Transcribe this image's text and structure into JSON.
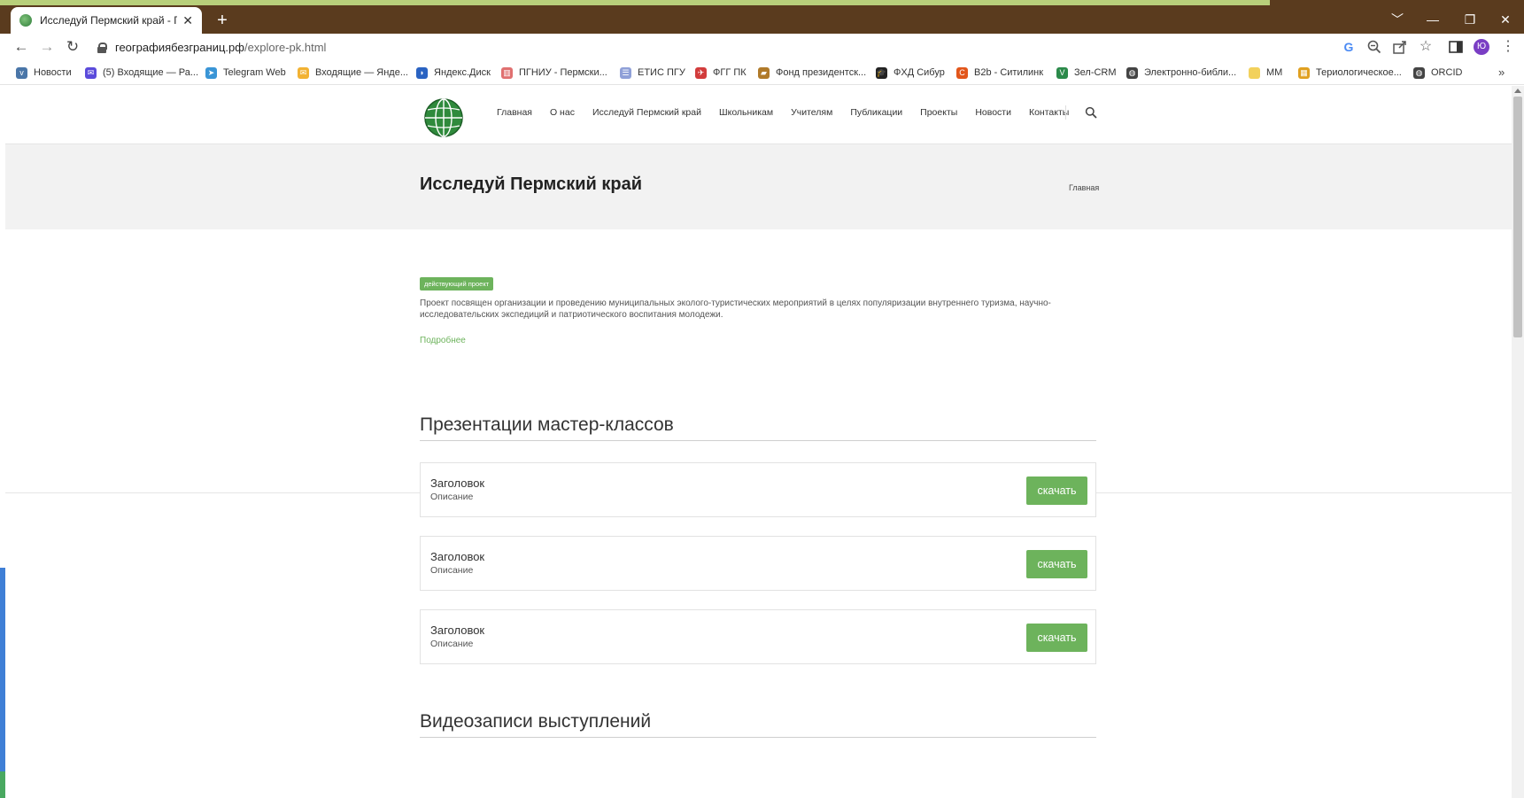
{
  "browser": {
    "tab_title": "Исследуй Пермский край - Геог",
    "tab_close": "✕",
    "new_tab": "+",
    "window_controls": [
      "﹀",
      "—",
      "❐",
      "✕"
    ],
    "url_host": "географиябезграниц.рф",
    "url_path": "/explore-pk.html",
    "profile_initial": "Ю",
    "bookmarks": [
      {
        "label": "Новости",
        "icon": "vk-icon",
        "color": "#4a76a8",
        "glyph": "v"
      },
      {
        "label": "(5) Входящие — Ра...",
        "icon": "mail-icon",
        "color": "#5b4bdb",
        "glyph": "✉"
      },
      {
        "label": "Telegram Web",
        "icon": "telegram-icon",
        "color": "#3a95d6",
        "glyph": "➤"
      },
      {
        "label": "Входящие — Янде...",
        "icon": "yandex-mail-icon",
        "color": "#f2b233",
        "glyph": "✉"
      },
      {
        "label": "Яндекс.Диск",
        "icon": "yandex-disk-icon",
        "color": "#2a63c2",
        "glyph": "◗"
      },
      {
        "label": "ПГНИУ - Пермски...",
        "icon": "pgniu-icon",
        "color": "#e07070",
        "glyph": "▥"
      },
      {
        "label": "ЕТИС ПГУ",
        "icon": "etis-icon",
        "color": "#8fa0d8",
        "glyph": "☰"
      },
      {
        "label": "ФГГ ПК",
        "icon": "fgg-icon",
        "color": "#d23c3c",
        "glyph": "✈"
      },
      {
        "label": "Фонд президентск...",
        "icon": "fund-icon",
        "color": "#b07a2a",
        "glyph": "▰"
      },
      {
        "label": "ФХД Сибур",
        "icon": "graduation-cap-icon",
        "color": "#222222",
        "glyph": "🎓"
      },
      {
        "label": "B2b - Ситилинк",
        "icon": "citilink-icon",
        "color": "#e2561b",
        "glyph": "C"
      },
      {
        "label": "Зел-CRM",
        "icon": "crm-icon",
        "color": "#2b8a4a",
        "glyph": "V"
      },
      {
        "label": "Электронно-библи...",
        "icon": "globe-icon",
        "color": "#444444",
        "glyph": "◍"
      },
      {
        "label": "ММ",
        "icon": "folder-icon",
        "color": "#f2d15c",
        "glyph": " "
      },
      {
        "label": "Териологическое...",
        "icon": "grid-icon",
        "color": "#e0a020",
        "glyph": "▦"
      },
      {
        "label": "ORCID",
        "icon": "globe-icon",
        "color": "#444444",
        "glyph": "◍"
      }
    ],
    "bookmarks_more": "»"
  },
  "site": {
    "nav": [
      "Главная",
      "О нас",
      "Исследуй Пермский край",
      "Школьникам",
      "Учителям",
      "Публикации",
      "Проекты",
      "Новости",
      "Контакты"
    ],
    "page_title": "Исследуй Пермский край",
    "breadcrumb": "Главная",
    "project": {
      "badge": "действующий проект",
      "description": "Проект посвящен организации и проведению муниципальных эколого-туристических мероприятий в целях популяризации внутреннего туризма, научно-исследовательских экспедиций и патриотического воспитания молодежи.",
      "more_link": "Подробнее"
    },
    "presentations": {
      "heading": "Презентации мастер-классов",
      "items": [
        {
          "title": "Заголовок",
          "description": "Описание",
          "button": "скачать"
        },
        {
          "title": "Заголовок",
          "description": "Описание",
          "button": "скачать"
        },
        {
          "title": "Заголовок",
          "description": "Описание",
          "button": "скачать"
        }
      ]
    },
    "videos": {
      "heading": "Видеозаписи выступлений"
    }
  },
  "colors": {
    "chrome_brown": "#5a3b1e",
    "accent_green": "#6db35c",
    "title_band": "#f2f2f2"
  }
}
